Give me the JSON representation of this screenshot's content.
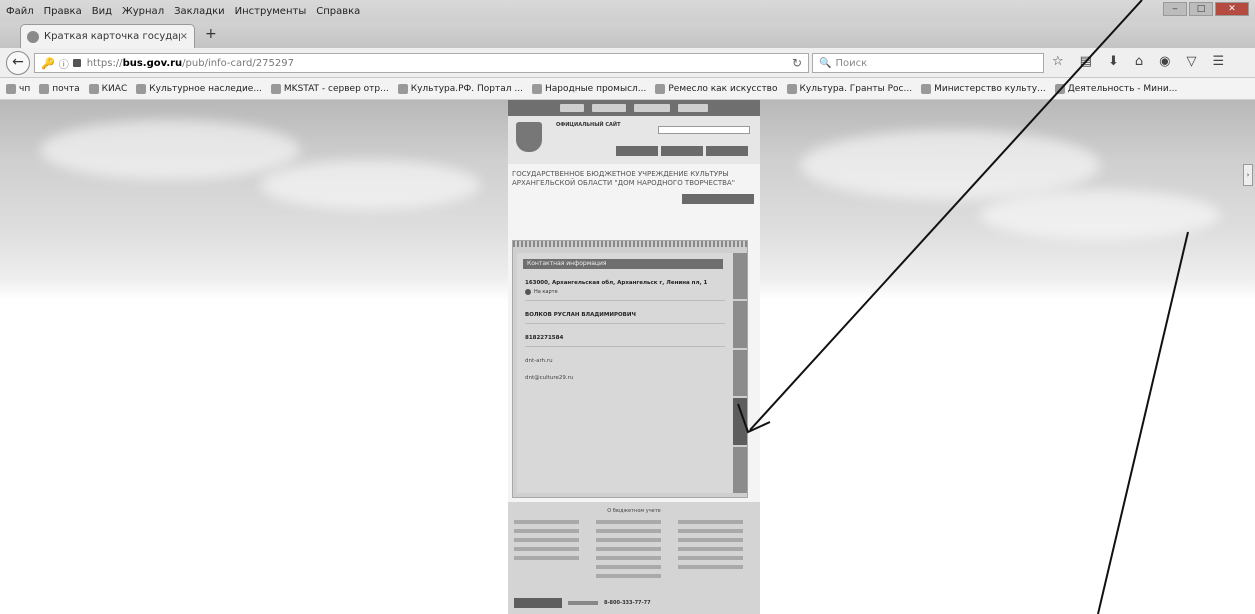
{
  "menu": {
    "items": [
      "Файл",
      "Правка",
      "Вид",
      "Журнал",
      "Закладки",
      "Инструменты",
      "Справка"
    ]
  },
  "tab": {
    "title": "Краткая карточка государ...",
    "close": "×",
    "new": "+"
  },
  "nav": {
    "url_prefix": "https://",
    "url_domain": "bus.gov.ru",
    "url_path": "/pub/info-card/275297",
    "search_placeholder": "Поиск"
  },
  "bookmarks": [
    "чп",
    "почта",
    "КИАС",
    "Культурное наследие...",
    "MKSTAT - сервер отр...",
    "Культура.РФ. Портал ...",
    "Народные промысл...",
    "Ремесло как искусство",
    "Культура. Гранты Рос...",
    "Министерство культу...",
    "Деятельность - Мини..."
  ],
  "site": {
    "official": "ОФИЦИАЛЬНЫЙ САЙТ",
    "org_title": "ГОСУДАРСТВЕННОЕ БЮДЖЕТНОЕ УЧРЕЖДЕНИЕ КУЛЬТУРЫ АРХАНГЕЛЬСКОЙ ОБЛАСТИ \"ДОМ НАРОДНОГО ТВОРЧЕСТВА\"",
    "card_head": "Контактная информация",
    "fields": {
      "address_value": "163000, Архангельская обл, Архангельск г, Ленина пл, 1",
      "map_link": "На карте",
      "director_value": "ВОЛКОВ РУСЛАН ВЛАДИМИРОВИЧ",
      "phone_value": "8182271584",
      "site_value": "dnt-arh.ru",
      "email_value": "dnt@culture29.ru"
    },
    "footer_title": "О бюджетном учете",
    "footer_phone": "8-800-333-77-77"
  },
  "colors": {
    "arrow": "#111111",
    "menubar": "#d4d4d4"
  }
}
